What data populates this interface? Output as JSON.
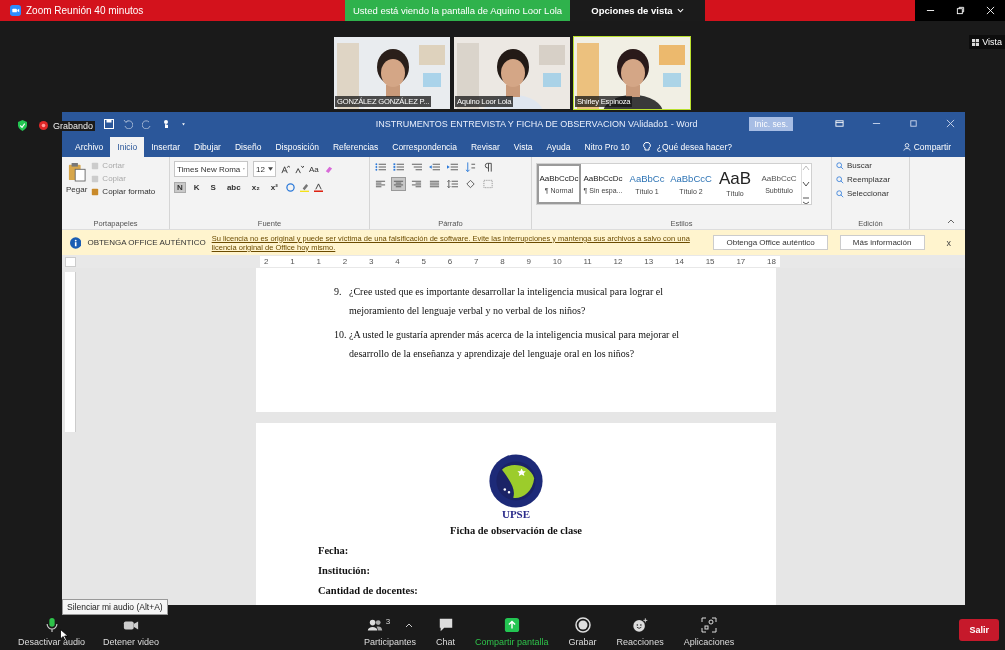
{
  "zoom": {
    "title": "Zoom Reunión 40 minutos",
    "banner": "Usted está viendo la pantalla de Aquino Loor Lola",
    "view_options": "Opciones de vista",
    "side_view": "Vista",
    "recording": "Grabando"
  },
  "participants": [
    {
      "name": "GONZÁLEZ GONZÁLEZ P...",
      "speaking": false
    },
    {
      "name": "Aquino Loor Lola",
      "speaking": false
    },
    {
      "name": "Shirley Espinoza",
      "speaking": true
    }
  ],
  "word": {
    "title": "INSTRUMENTOS ENTREVISTA Y FICHA DE OBSERVACION  VAlidado1  -  Word",
    "sign_in": "Inic. ses.",
    "tabs": [
      {
        "label": "Archivo",
        "selected": false
      },
      {
        "label": "Inicio",
        "selected": true
      },
      {
        "label": "Insertar",
        "selected": false
      },
      {
        "label": "Dibujar",
        "selected": false
      },
      {
        "label": "Diseño",
        "selected": false
      },
      {
        "label": "Disposición",
        "selected": false
      },
      {
        "label": "Referencias",
        "selected": false
      },
      {
        "label": "Correspondencia",
        "selected": false
      },
      {
        "label": "Revisar",
        "selected": false
      },
      {
        "label": "Vista",
        "selected": false
      },
      {
        "label": "Ayuda",
        "selected": false
      },
      {
        "label": "Nitro Pro 10",
        "selected": false
      }
    ],
    "tell_me": "¿Qué desea hacer?",
    "share": "Compartir",
    "clipboard": {
      "paste": "Pegar",
      "items": [
        {
          "label": "Cortar",
          "disabled": true
        },
        {
          "label": "Copiar",
          "disabled": true
        },
        {
          "label": "Copiar formato",
          "disabled": false
        }
      ],
      "group": "Portapapeles"
    },
    "font": {
      "name": "Times New Roma",
      "size": "12",
      "case": "Aa",
      "buttons": [
        {
          "label": "N",
          "selected": true
        },
        {
          "label": "K",
          "selected": false
        },
        {
          "label": "S",
          "selected": false
        },
        {
          "label": "abc",
          "selected": false
        },
        {
          "label": "x₂",
          "selected": false
        },
        {
          "label": "x²",
          "selected": false
        }
      ],
      "group": "Fuente"
    },
    "paragraph": {
      "group": "Párrafo",
      "alignment": [
        {
          "selected": false
        },
        {
          "selected": true
        },
        {
          "selected": false
        },
        {
          "selected": false
        }
      ]
    },
    "styles": {
      "group": "Estilos",
      "items": [
        {
          "preview": "AaBbCcDc",
          "name": "¶ Normal",
          "selected": true
        },
        {
          "preview": "AaBbCcDc",
          "name": "¶ Sin espa...",
          "selected": false
        },
        {
          "preview": "AaBbCc",
          "name": "Título 1",
          "selected": false
        },
        {
          "preview": "AaBbCcC",
          "name": "Título 2",
          "selected": false
        },
        {
          "preview": "AaB",
          "name": "Título",
          "selected": false
        },
        {
          "preview": "AaBbCcC",
          "name": "Subtítulo",
          "selected": false
        }
      ]
    },
    "editing": {
      "group": "Edición",
      "items": [
        "Buscar",
        "Reemplazar",
        "Seleccionar"
      ]
    },
    "notice": {
      "label": "OBTENGA OFFICE AUTÉNTICO",
      "message": "Su licencia no es original y puede ser víctima de una falsificación de software. Evite las interrupciones y mantenga sus archivos a salvo con una licencia original de Office hoy mismo.",
      "buttons": [
        "Obtenga Office auténtico",
        "Más información"
      ],
      "close": "x"
    },
    "ruler": [
      "2",
      "1",
      "1",
      "2",
      "3",
      "4",
      "5",
      "6",
      "7",
      "8",
      "9",
      "10",
      "11",
      "12",
      "13",
      "14",
      "15",
      "17",
      "18"
    ]
  },
  "document": {
    "questions": [
      {
        "number": "9.",
        "text": "¿Cree usted que es importante desarrollar la inteligencia musical para lograr el mejoramiento del lenguaje verbal y no verbal de los niños?"
      },
      {
        "number": "10.",
        "text": "¿A usted le gustaría aprender más acerca de la inteligencia musical para mejorar el desarrollo de la enseñanza y aprendizaje del lenguaje oral en los niños?"
      }
    ],
    "logo_text": "UPSE",
    "heading": "Ficha de observación de clase",
    "fields": [
      "Fecha:",
      "Institución:",
      "Cantidad de docentes:"
    ]
  },
  "toolbar": {
    "tooltip": "Silenciar mi audio (Alt+A)",
    "items": [
      {
        "label": "Desactivar audio",
        "kind": "mic"
      },
      {
        "label": "Detener video",
        "kind": "video"
      },
      {
        "label": "Participantes",
        "kind": "participants",
        "count": "3"
      },
      {
        "label": "Chat",
        "kind": "chat"
      },
      {
        "label": "Compartir pantalla",
        "kind": "share"
      },
      {
        "label": "Grabar",
        "kind": "record"
      },
      {
        "label": "Reacciones",
        "kind": "reactions"
      },
      {
        "label": "Aplicaciones",
        "kind": "apps"
      }
    ],
    "leave": "Salir"
  }
}
